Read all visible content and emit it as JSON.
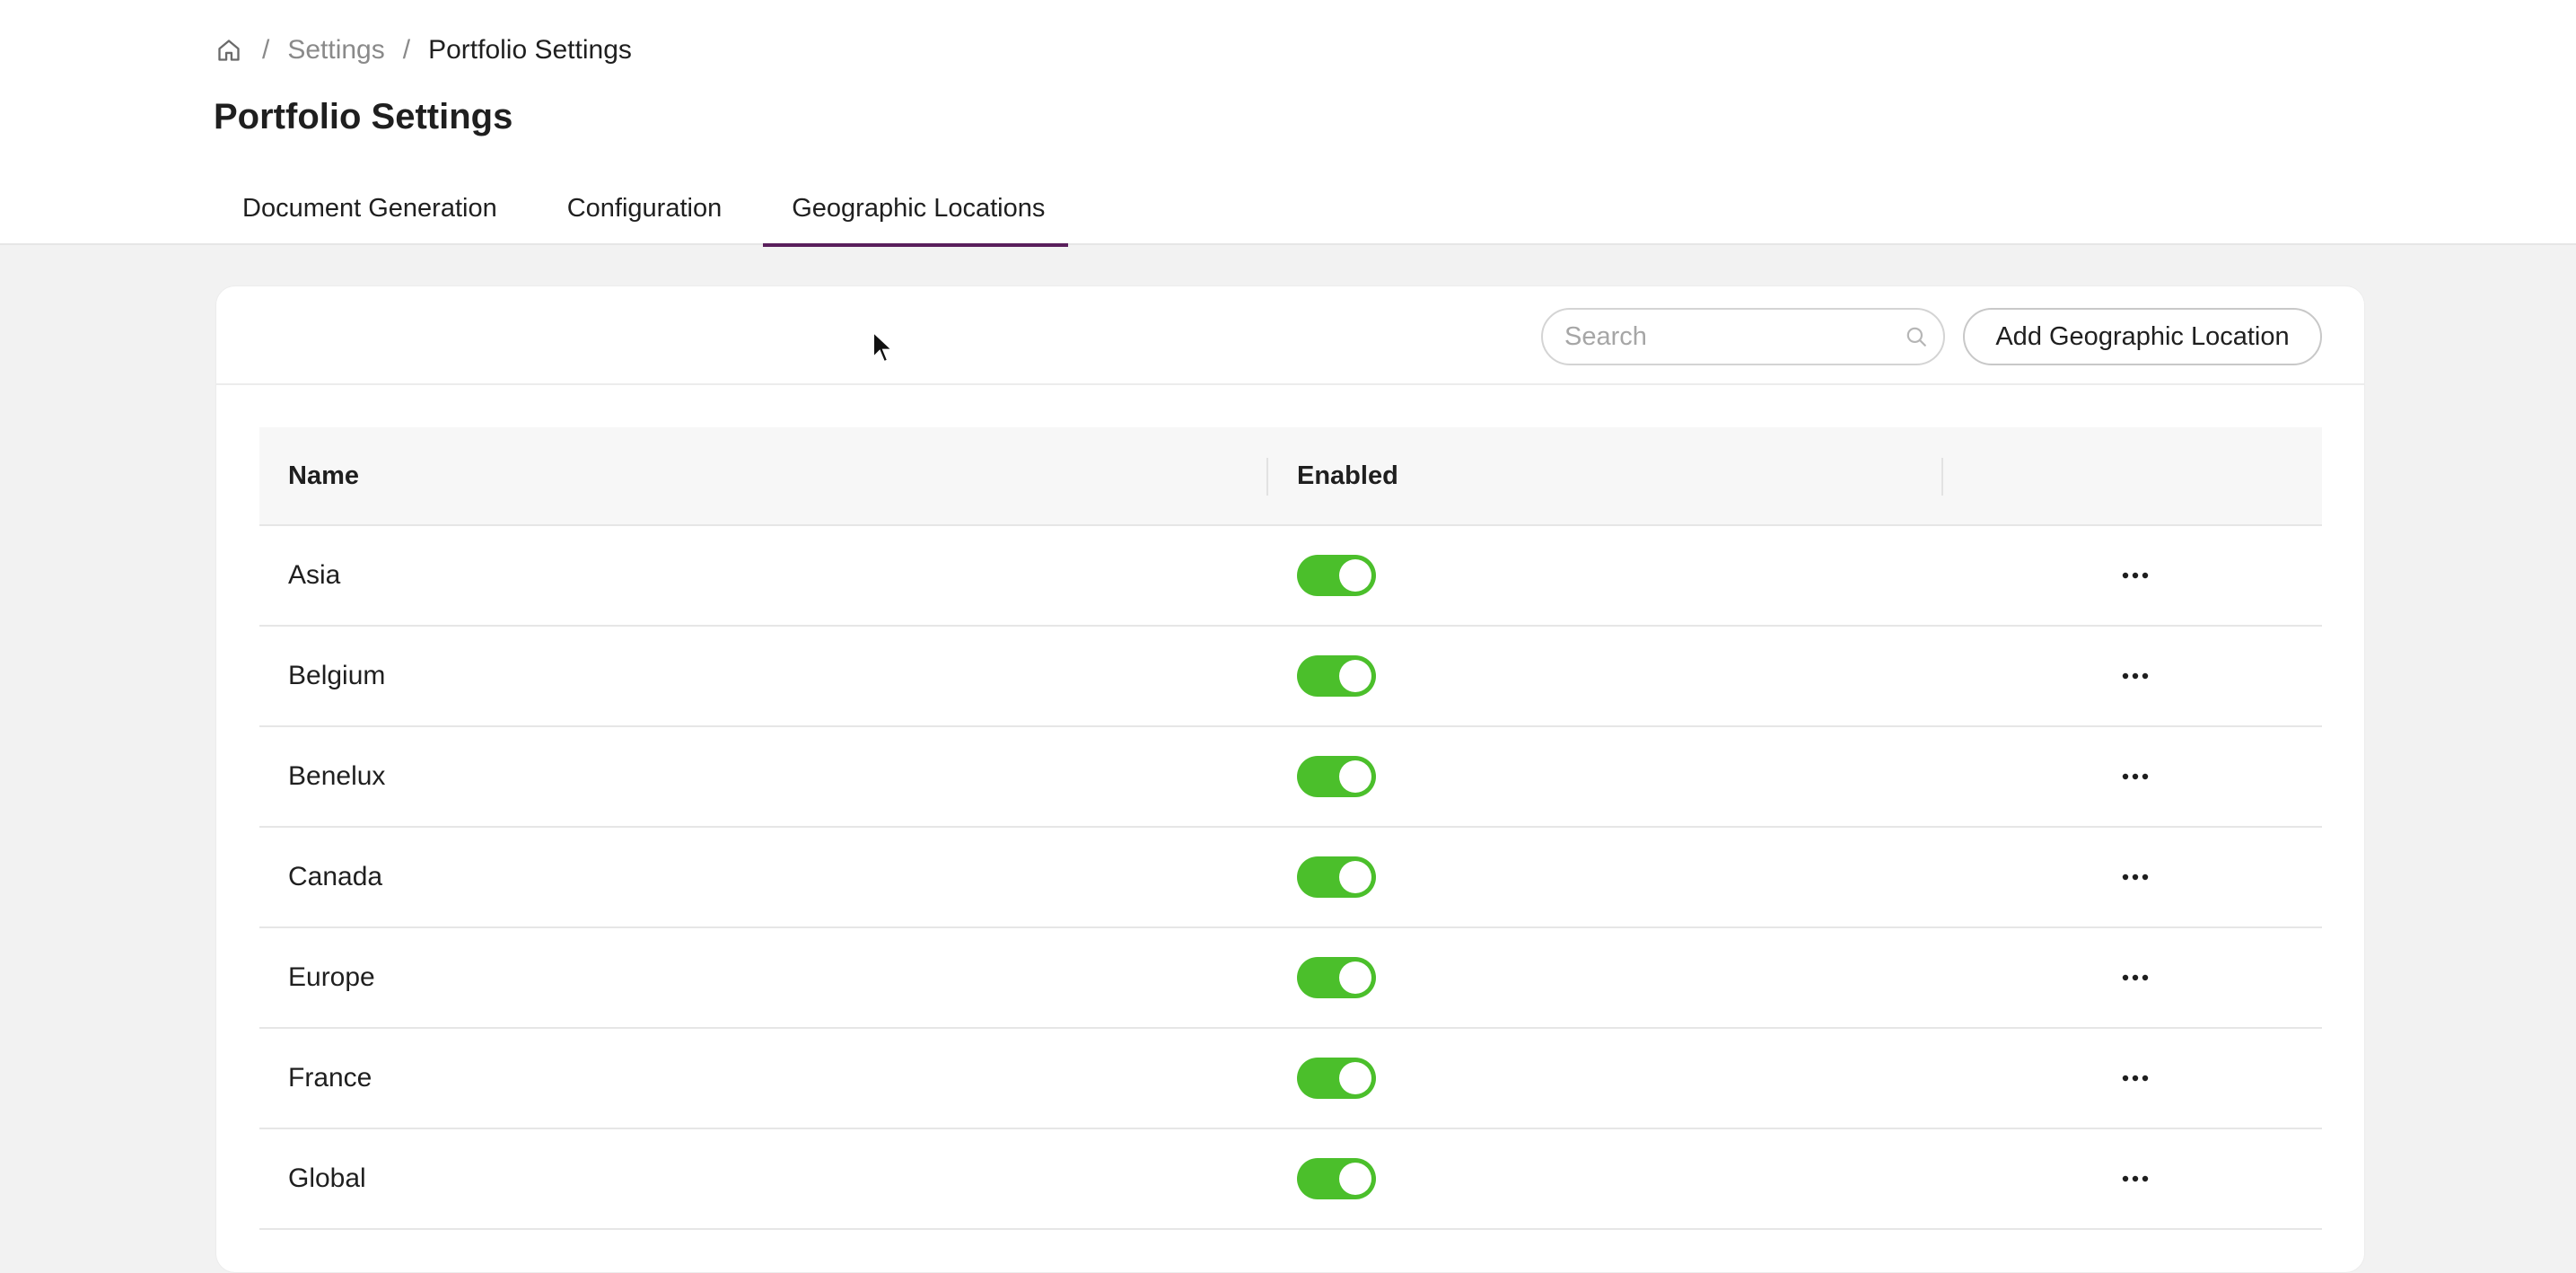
{
  "breadcrumb": {
    "items": [
      "Settings",
      "Portfolio Settings"
    ],
    "separator": "/"
  },
  "page": {
    "title": "Portfolio Settings"
  },
  "tabs": [
    {
      "label": "Document Generation",
      "active": false
    },
    {
      "label": "Configuration",
      "active": false
    },
    {
      "label": "Geographic Locations",
      "active": true
    }
  ],
  "toolbar": {
    "search_placeholder": "Search",
    "add_button_label": "Add Geographic Location"
  },
  "table": {
    "columns": [
      "Name",
      "Enabled",
      ""
    ],
    "rows": [
      {
        "name": "Asia",
        "enabled": true
      },
      {
        "name": "Belgium",
        "enabled": true
      },
      {
        "name": "Benelux",
        "enabled": true
      },
      {
        "name": "Canada",
        "enabled": true
      },
      {
        "name": "Europe",
        "enabled": true
      },
      {
        "name": "France",
        "enabled": true
      },
      {
        "name": "Global",
        "enabled": true
      }
    ]
  },
  "icons": {
    "home": "home-icon",
    "search": "search-icon",
    "row_actions": "more-horizontal-icon"
  },
  "colors": {
    "accent": "#5a1f5c",
    "toggle_on": "#4bbf2b",
    "background": "#f2f2f2"
  }
}
